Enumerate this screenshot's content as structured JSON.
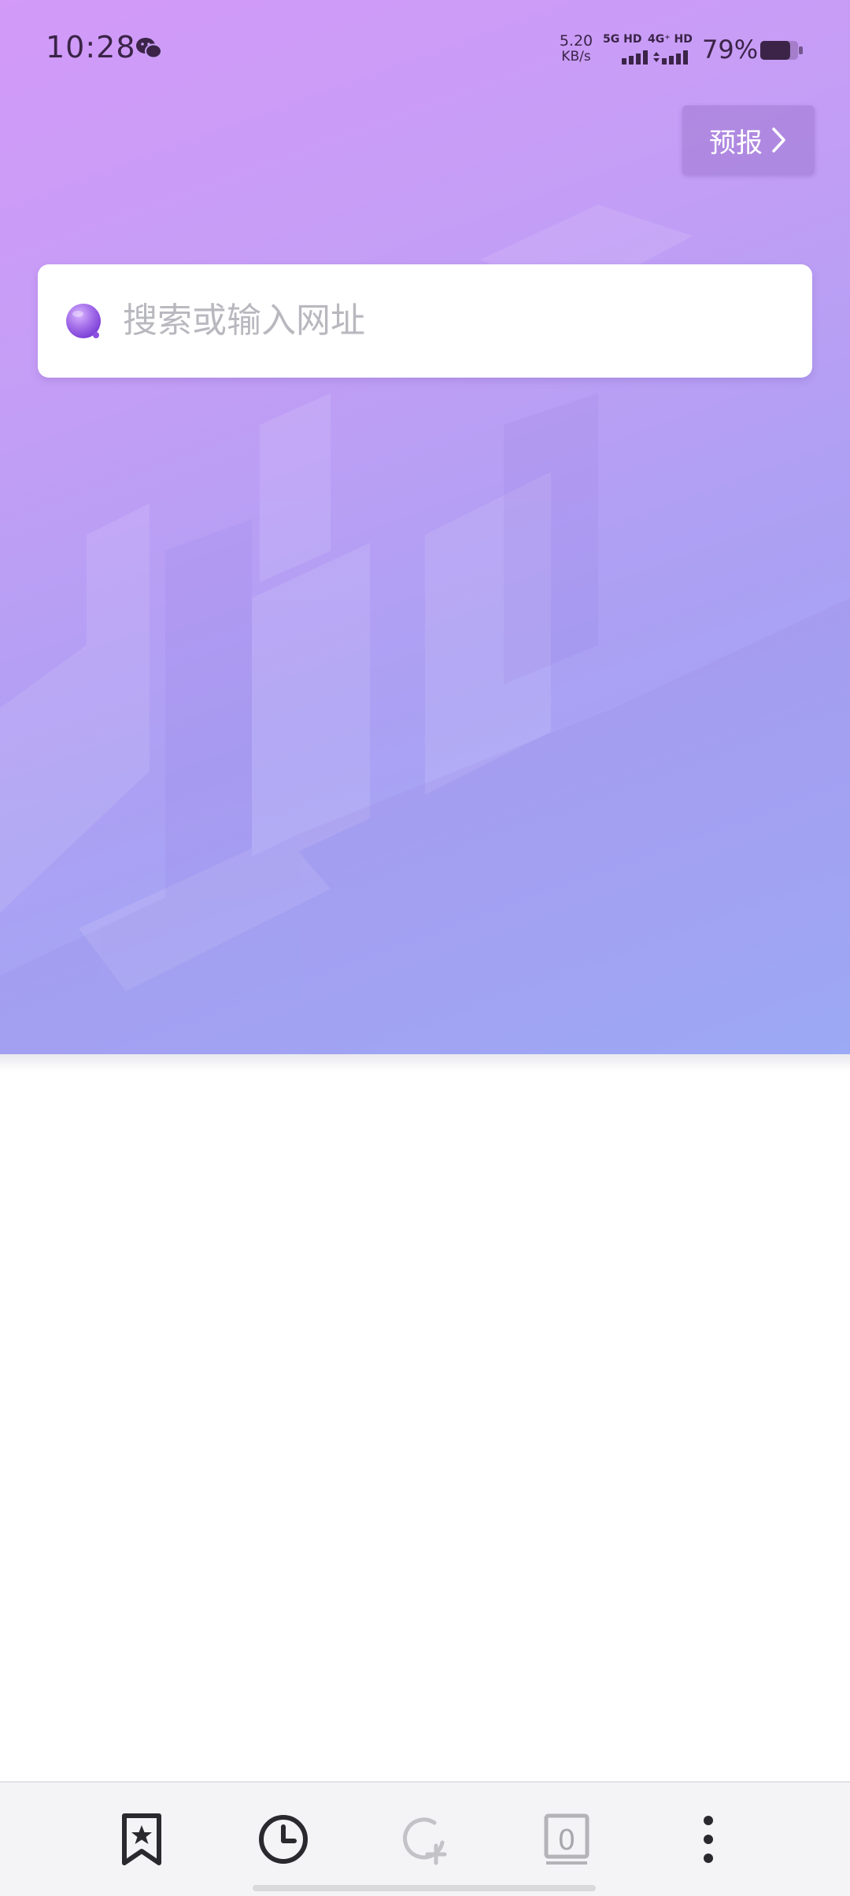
{
  "status_bar": {
    "time": "10:28",
    "net_speed_value": "5.20",
    "net_speed_unit": "KB/s",
    "sim1_label": "5G HD",
    "sim2_label": "4G⁺ HD",
    "battery_percent": "79%",
    "battery_level": 0.79
  },
  "header": {
    "forecast_label": "预报"
  },
  "search": {
    "placeholder": "搜索或输入网址"
  },
  "toolbar": {
    "tab_count": "0",
    "items": [
      "bookmarks-icon",
      "history-icon",
      "add-tab-icon",
      "tabs-icon",
      "more-icon"
    ]
  },
  "colors": {
    "accent": "#a36de9",
    "hero_top": "#d39af8",
    "hero_bottom": "#9fb0f8",
    "toolbar_icon": "#2a2a2e",
    "toolbar_icon_disabled": "#b3b3b8"
  }
}
